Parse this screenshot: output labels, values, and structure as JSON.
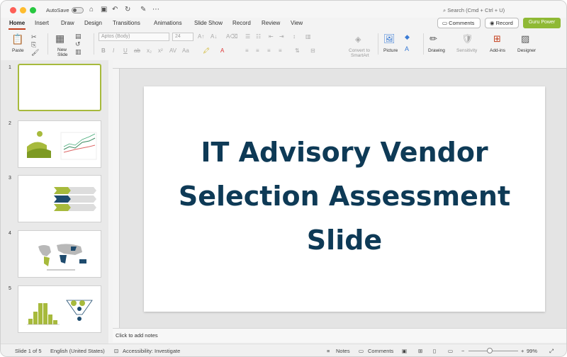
{
  "titlebar": {
    "autosave_label": "AutoSave",
    "search_placeholder": "Search (Cmd + Ctrl + U)"
  },
  "ribbon_tabs": [
    "Home",
    "Insert",
    "Draw",
    "Design",
    "Transitions",
    "Animations",
    "Slide Show",
    "Record",
    "Review",
    "View"
  ],
  "header_buttons": {
    "comments": "Comments",
    "record": "Record",
    "guru": "Guru Power"
  },
  "toolbar": {
    "paste": "Paste",
    "new_slide_line1": "New",
    "new_slide_line2": "Slide",
    "font_name": "Aptos (Body)",
    "font_size": "24",
    "convert_line1": "Convert to",
    "convert_line2": "SmartArt",
    "picture": "Picture",
    "drawing": "Drawing",
    "sensitivity": "Sensitivity",
    "addins": "Add-ins",
    "designer": "Designer"
  },
  "slides": [
    "1",
    "2",
    "3",
    "4",
    "5"
  ],
  "slide_title": "IT Advisory Vendor Selection Assessment Slide",
  "notes_placeholder": "Click to add notes",
  "status": {
    "slide_counter": "Slide 1 of 5",
    "language": "English (United States)",
    "accessibility": "Accessibility: Investigate",
    "notes": "Notes",
    "comments": "Comments",
    "zoom": "99%"
  },
  "colors": {
    "accent_tab": "#c43e1c",
    "guru_green": "#8fb935",
    "title_navy": "#0e3a56",
    "thumb_green": "#a7ba3c"
  }
}
